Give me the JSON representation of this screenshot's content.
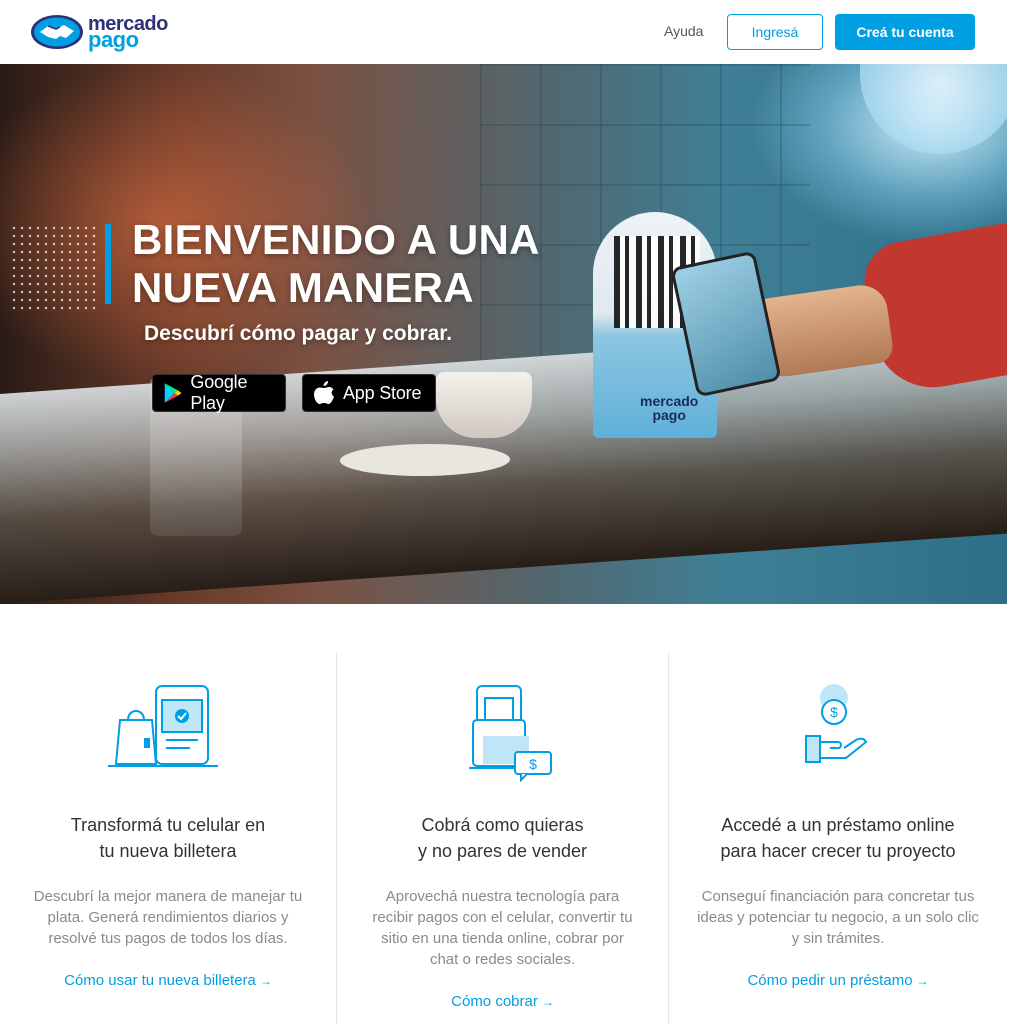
{
  "header": {
    "logo_line1": "mercado",
    "logo_line2": "pago",
    "help": "Ayuda",
    "login": "Ingresá",
    "signup": "Creá tu cuenta"
  },
  "hero": {
    "title_line1": "BIENVENIDO A UNA",
    "title_line2": "NUEVA MANERA",
    "subtitle": "Descubrí cómo pagar y cobrar.",
    "google_play": "Google Play",
    "app_store": "App Store",
    "stand_logo_line1": "mercado",
    "stand_logo_line2": "pago"
  },
  "features": [
    {
      "title_line1": "Transformá tu celular en",
      "title_line2": "tu nueva billetera",
      "description": "Descubrí la mejor manera de manejar tu plata. Generá rendimientos diarios y resolvé tus pagos de todos los días.",
      "link": "Cómo usar tu nueva billetera"
    },
    {
      "title_line1": "Cobrá como quieras",
      "title_line2": "y no pares de vender",
      "description": "Aprovechá nuestra tecnología para recibir pagos con el celular, convertir tu sitio en una tienda online, cobrar por chat o redes sociales.",
      "link": "Cómo cobrar"
    },
    {
      "title_line1": "Accedé a un préstamo online",
      "title_line2": "para hacer crecer tu proyecto",
      "description": "Conseguí financiación para concretar tus ideas y potenciar tu negocio, a un solo clic y sin trámites.",
      "link": "Cómo pedir un préstamo"
    }
  ],
  "colors": {
    "brand_blue": "#009ee3",
    "brand_navy": "#2d3277"
  },
  "icons": {
    "arrow": "→"
  }
}
